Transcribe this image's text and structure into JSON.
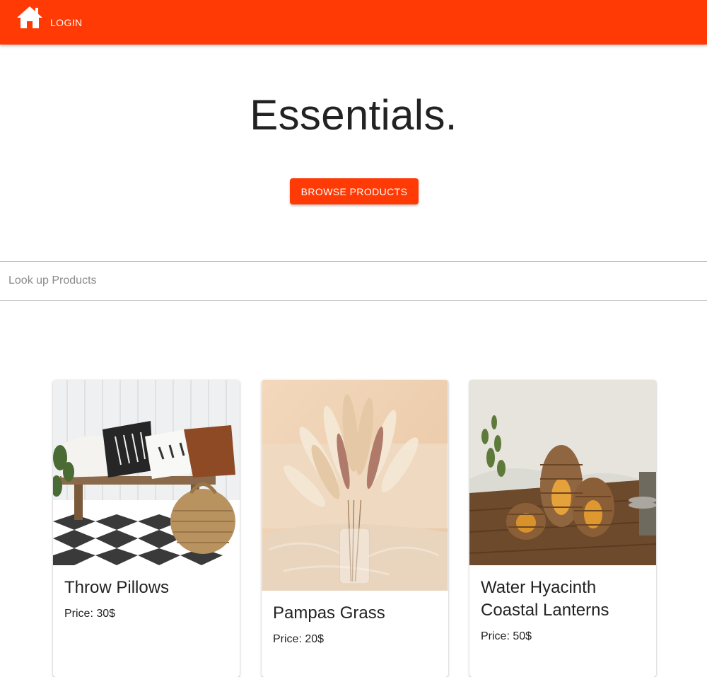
{
  "appbar": {
    "home_icon": "home-icon",
    "login_label": "LOGIN",
    "color": "#ff3a05"
  },
  "hero": {
    "title": "Essentials.",
    "browse_label": "BROWSE PRODUCTS"
  },
  "search": {
    "placeholder": "Look up Products",
    "value": ""
  },
  "products": [
    {
      "title": "Throw Pillows",
      "price": "Price: 30$",
      "image": "throw-pillows-photo"
    },
    {
      "title": "Pampas Grass",
      "price": "Price: 20$",
      "image": "pampas-grass-photo"
    },
    {
      "title": "Water Hyacinth Coastal Lanterns",
      "price": "Price: 50$",
      "image": "lanterns-photo"
    }
  ]
}
